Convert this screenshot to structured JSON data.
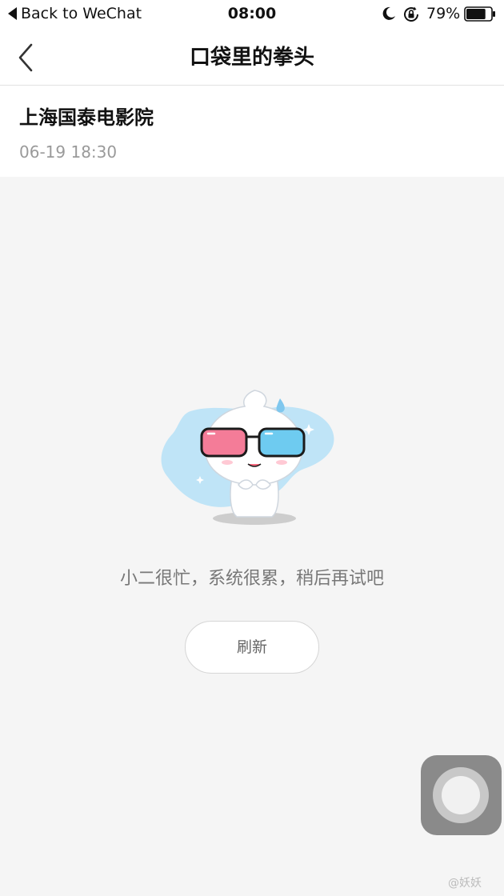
{
  "status_bar": {
    "back_app": "Back to WeChat",
    "time": "08:00",
    "battery": "79%",
    "battery_level": 0.79
  },
  "nav": {
    "title": "口袋里的拳头",
    "back_icon": "chevron-left-icon"
  },
  "cinema": {
    "name": "上海国泰电影院",
    "datetime": "06-19 18:30"
  },
  "error_state": {
    "message": "小二很忙，系统很累，稍后再试吧",
    "refresh_label": "刷新",
    "illustration": "mascot-with-3d-glasses-icon"
  },
  "watermark": "@妖妖"
}
